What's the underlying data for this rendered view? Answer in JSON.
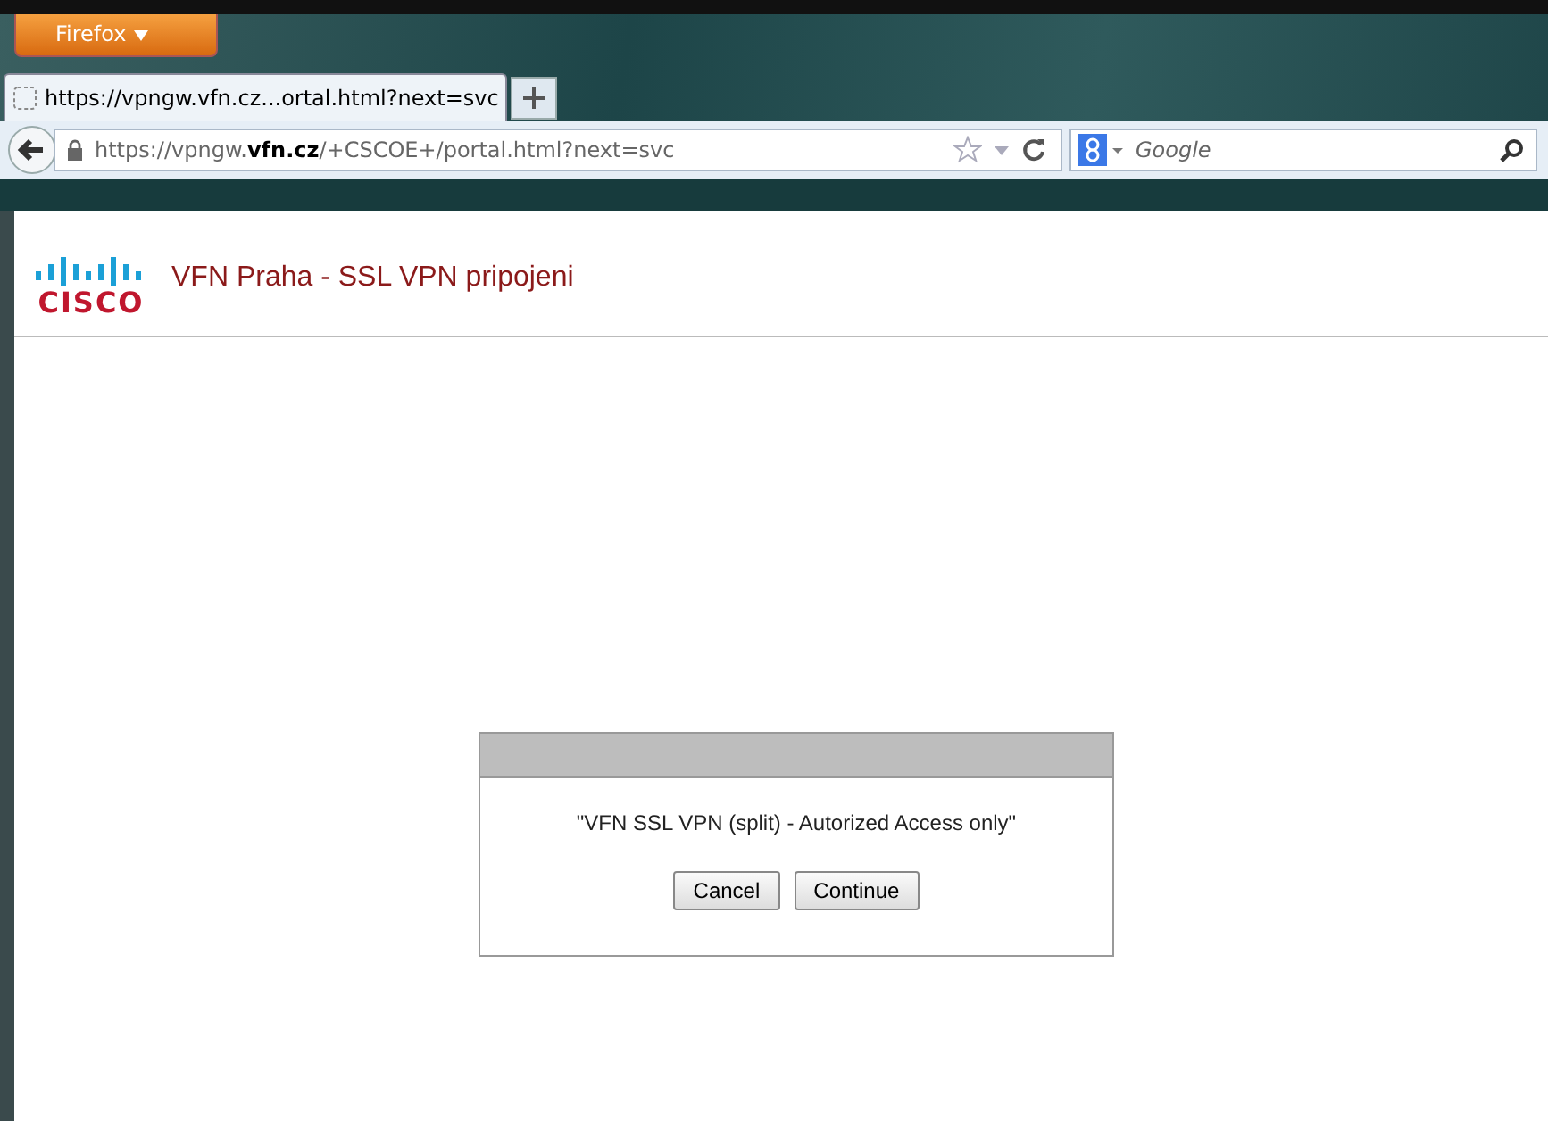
{
  "app_menu": {
    "label": "Firefox"
  },
  "tabs": [
    {
      "label": "https://vpngw.vfn.cz...ortal.html?next=svc",
      "selected": true
    }
  ],
  "address_bar": {
    "url": "https://vpngw.**vfn.cz**/+CSCOE+/portal.html?next=svc"
  },
  "search": {
    "placeholder": "Google"
  },
  "header": {
    "logo_text": "CISCO",
    "title": "VFN Praha - SSL VPN pripojeni"
  },
  "dialog": {
    "message": "\"VFN SSL VPN (split) - Autorized Access only\"",
    "buttons": [
      "Cancel",
      "Continue"
    ]
  }
}
